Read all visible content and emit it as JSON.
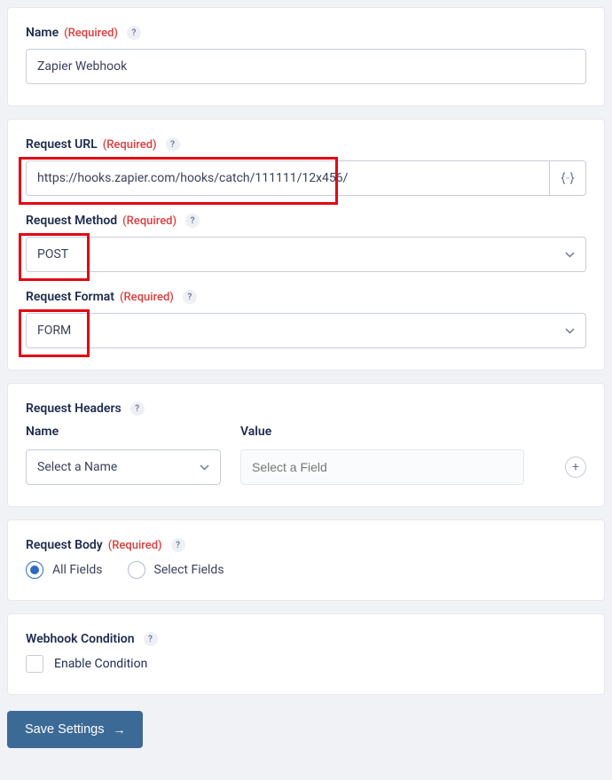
{
  "labels": {
    "name": "Name",
    "required": "(Required)",
    "requestUrl": "Request URL",
    "requestMethod": "Request Method",
    "requestFormat": "Request Format",
    "requestHeaders": "Request Headers",
    "headerName": "Name",
    "headerValue": "Value",
    "requestBody": "Request Body",
    "allFields": "All Fields",
    "selectFields": "Select Fields",
    "webhookCondition": "Webhook Condition",
    "enableCondition": "Enable Condition",
    "saveSettings": "Save Settings"
  },
  "values": {
    "name": "Zapier Webhook",
    "requestUrl": "https://hooks.zapier.com/hooks/catch/111111/12x456/",
    "requestMethod": "POST",
    "requestFormat": "FORM",
    "headerNameSelected": "Select a Name",
    "headerValuePlaceholder": "Select a Field",
    "bodySelection": "all",
    "enableCondition": false
  },
  "icons": {
    "help": "?",
    "plus": "+",
    "arrow": "→"
  }
}
